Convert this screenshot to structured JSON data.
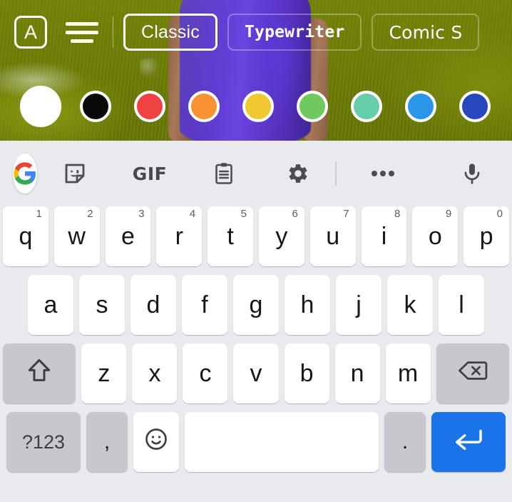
{
  "app": {
    "name": "photo-text-editor-with-keyboard"
  },
  "editor": {
    "toolbar": {
      "text_style_icon": "text-format-icon",
      "text_style_label": "A",
      "align_icon": "text-align-center-icon",
      "fonts": [
        {
          "label": "Classic",
          "selected": true
        },
        {
          "label": "Typewriter",
          "selected": false
        },
        {
          "label": "Comic S",
          "selected": false
        }
      ]
    },
    "colors": {
      "selected_index": 0,
      "swatches": [
        {
          "name": "white",
          "hex": "#ffffff",
          "selected": true
        },
        {
          "name": "black",
          "hex": "#0a0a0a",
          "selected": false
        },
        {
          "name": "red",
          "hex": "#ef4343",
          "selected": false
        },
        {
          "name": "orange",
          "hex": "#f89334",
          "selected": false
        },
        {
          "name": "yellow",
          "hex": "#f0c832",
          "selected": false
        },
        {
          "name": "green",
          "hex": "#6fc95e",
          "selected": false
        },
        {
          "name": "teal-green",
          "hex": "#67ceab",
          "selected": false
        },
        {
          "name": "light-blue",
          "hex": "#2b95e9",
          "selected": false
        },
        {
          "name": "dark-blue",
          "hex": "#2747bd",
          "selected": false
        }
      ]
    }
  },
  "keyboard": {
    "background_hex": "#e9eaee",
    "key_hex": "#ffffff",
    "modifier_key_hex": "#c6c8cd",
    "enter_key_hex": "#1a73e8",
    "toolbar": [
      {
        "name": "google-logo-icon",
        "label": ""
      },
      {
        "name": "sticker-icon",
        "label": ""
      },
      {
        "name": "gif-icon",
        "label": "GIF"
      },
      {
        "name": "clipboard-icon",
        "label": ""
      },
      {
        "name": "gear-icon",
        "label": ""
      },
      {
        "name": "divider",
        "label": ""
      },
      {
        "name": "more-options-icon",
        "label": ""
      },
      {
        "name": "microphone-icon",
        "label": ""
      }
    ],
    "rows": {
      "row1": [
        {
          "key": "q",
          "num": "1"
        },
        {
          "key": "w",
          "num": "2"
        },
        {
          "key": "e",
          "num": "3"
        },
        {
          "key": "r",
          "num": "4"
        },
        {
          "key": "t",
          "num": "5"
        },
        {
          "key": "y",
          "num": "6"
        },
        {
          "key": "u",
          "num": "7"
        },
        {
          "key": "i",
          "num": "8"
        },
        {
          "key": "o",
          "num": "9"
        },
        {
          "key": "p",
          "num": "0"
        }
      ],
      "row2": [
        {
          "key": "a"
        },
        {
          "key": "s"
        },
        {
          "key": "d"
        },
        {
          "key": "f"
        },
        {
          "key": "g"
        },
        {
          "key": "h"
        },
        {
          "key": "j"
        },
        {
          "key": "k"
        },
        {
          "key": "l"
        }
      ],
      "row3": [
        {
          "key": "shift",
          "icon": "shift-arrow-icon"
        },
        {
          "key": "z"
        },
        {
          "key": "x"
        },
        {
          "key": "c"
        },
        {
          "key": "v"
        },
        {
          "key": "b"
        },
        {
          "key": "n"
        },
        {
          "key": "m"
        },
        {
          "key": "backspace",
          "icon": "backspace-icon"
        }
      ],
      "row4": [
        {
          "key": "symbols",
          "label": "?123"
        },
        {
          "key": "comma",
          "label": ","
        },
        {
          "key": "emoji",
          "icon": "emoji-smiley-icon"
        },
        {
          "key": "space",
          "label": ""
        },
        {
          "key": "period",
          "label": "."
        },
        {
          "key": "enter",
          "icon": "enter-return-icon"
        }
      ]
    }
  }
}
